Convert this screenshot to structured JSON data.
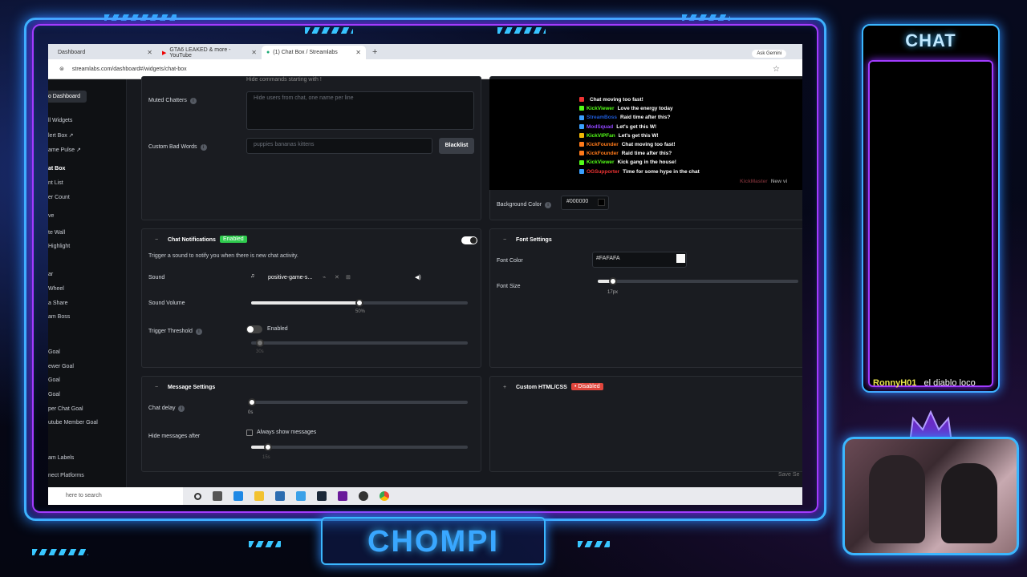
{
  "browser": {
    "tabs": [
      {
        "label": "Dashboard"
      },
      {
        "label": "GTA6 LEAKED & more - YouTube"
      },
      {
        "label": "(1) Chat Box / Streamlabs"
      }
    ],
    "new_tab": "+",
    "gemini": "Ask Gemini",
    "url": "streamlabs.com/dashboard#/widgets/chat-box"
  },
  "sidebar": {
    "back": "to Dashboard",
    "items": [
      "ll Widgets",
      "lert Box ↗",
      "ame Pulse ↗",
      "at Box",
      "nt List",
      "er Count",
      "ve",
      "te Wall",
      "Highlight",
      "ar",
      "Wheel",
      "a Share",
      "am Boss",
      "Goal",
      "ewer Goal",
      "Goal",
      "Goal",
      "per Chat Goal",
      "utube Member Goal",
      "am Labels",
      "nect Platforms"
    ]
  },
  "chat_box": {
    "hide_commands": "Hide commands starting with !",
    "muted_label": "Muted Chatters",
    "muted_placeholder": "Hide users from chat, one name per line",
    "bad_words_label": "Custom Bad Words",
    "bad_words_placeholder": "puppies bananas kittens",
    "blacklist": "Blacklist"
  },
  "notifications": {
    "title": "Chat Notifications",
    "enabled_badge": "Enabled",
    "description": "Trigger a sound to notify you when there is new chat activity.",
    "sound_label": "Sound",
    "sound_file": "positive-game-s...",
    "volume_label": "Sound Volume",
    "volume_value": 0.5,
    "volume_text": "50%",
    "threshold_label": "Trigger Threshold",
    "threshold_toggle": "Enabled",
    "threshold_value": "30s"
  },
  "message": {
    "title": "Message Settings",
    "delay_label": "Chat delay",
    "delay_value": "0s",
    "hide_label": "Hide messages after",
    "always_show": "Always show messages",
    "hide_value": "15s"
  },
  "preview": {
    "lines": [
      {
        "user": "",
        "msg": "Chat moving too fast!",
        "color": "#1e5bd8",
        "icon": "#e33"
      },
      {
        "user": "KickViewer",
        "msg": "Love the energy today",
        "color": "#53fc18",
        "icon": "#53fc18"
      },
      {
        "user": "StreamBoss",
        "msg": "Raid time after this?",
        "color": "#1e5bd8",
        "icon": "#3aa0ff"
      },
      {
        "user": "ModSquad",
        "msg": "Let's get this W!",
        "color": "#9146ff",
        "icon": "#3aa0ff"
      },
      {
        "user": "KickVIPFan",
        "msg": "Let's get this W!",
        "color": "#53fc18",
        "icon": "#f2b705"
      },
      {
        "user": "KickFounder",
        "msg": "Chat moving too fast!",
        "color": "#ff7a1a",
        "icon": "#ff7a1a"
      },
      {
        "user": "KickFounder",
        "msg": "Raid time after this?",
        "color": "#ff7a1a",
        "icon": "#ff7a1a"
      },
      {
        "user": "KickViewer",
        "msg": "Kick gang in the house!",
        "color": "#53fc18",
        "icon": "#53fc18"
      },
      {
        "user": "OGSupporter",
        "msg": "Time for some hype in the chat",
        "color": "#e33",
        "icon": "#3aa0ff"
      }
    ],
    "trailing": {
      "user": "KickMaster",
      "msg": "New vi"
    }
  },
  "background": {
    "label": "Background Color",
    "value": "#000000"
  },
  "font": {
    "title": "Font Settings",
    "color_label": "Font Color",
    "color_value": "#FAFAFA",
    "size_label": "Font Size",
    "size_value": "17px"
  },
  "custom_html": {
    "title": "Custom HTML/CSS",
    "badge": "• Disabled"
  },
  "save": "Save Se",
  "taskbar": {
    "search": "here to search"
  },
  "overlay": {
    "chat_title": "CHAT",
    "chat_user": "RonnyH01",
    "chat_msg": "el diablo loco",
    "logo": "CHOMPI"
  },
  "colors": {
    "accent_blue": "#3bb7ff",
    "accent_purple": "#a23bff",
    "enabled": "#2fcb4e",
    "disabled": "#e0453c"
  }
}
